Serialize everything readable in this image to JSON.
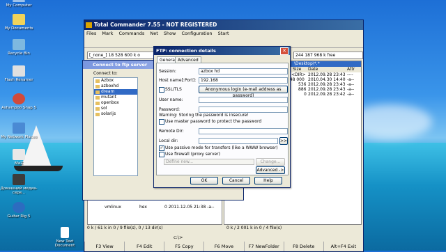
{
  "desktop": {
    "icons": [
      {
        "label": "My Computer"
      },
      {
        "label": "My Documents"
      },
      {
        "label": "Recycle Bin"
      },
      {
        "label": "Flash Renamer"
      },
      {
        "label": "Ashampoo Snap 5"
      },
      {
        "label": "My Network Places"
      },
      {
        "label": "MaZ"
      },
      {
        "label": "Домашний медиа-серв..."
      },
      {
        "label": "Guitar Rig 5"
      },
      {
        "label": "New Text Document"
      }
    ]
  },
  "tc": {
    "title": "Total Commander 7.55 - NOT REGISTERED",
    "menu": [
      "Files",
      "Mark",
      "Commands",
      "Net",
      "Show",
      "Configuration",
      "Start"
    ],
    "left_drive": "[_none_]  18 528 600 k o",
    "right_drive": "244 187 968 k free",
    "right_path": "\\Desktop\\*.*",
    "right_cols": [
      "Size",
      "Date",
      "Attr"
    ],
    "right_rows": [
      {
        "size": "<DIR>",
        "date": "2012.09.28 23:43",
        "attr": "----"
      },
      {
        "size": "048 000",
        "date": "2010.04.30 14:40",
        "attr": "-a--"
      },
      {
        "size": "536",
        "date": "2012.09.28 23:43",
        "attr": "-a--"
      },
      {
        "size": "886",
        "date": "2012.09.28 23:43",
        "attr": "-a--"
      },
      {
        "size": "0",
        "date": "2012.09.28 23:42",
        "attr": "-a--"
      }
    ],
    "left_bottom_rows": [
      {
        "name": "vmlinux",
        "ext": "hex",
        "info": "0  2011.12.05 21:38 -a--"
      }
    ],
    "left_status": "0 k / 61 k in 0 / 9 file(s), 0 / 13 dir(s)",
    "right_status": "0 k / 2 001 k in 0 / 4 file(s)",
    "cmd_prompt": "c:\\>",
    "fkeys": [
      "F3 View",
      "F4 Edit",
      "F5 Copy",
      "F6 Move",
      "F7 NewFolder",
      "F8 Delete",
      "Alt+F4 Exit"
    ]
  },
  "ftp": {
    "title": "Connect to ftp server",
    "list_label": "Connect to:",
    "items": [
      "Azbox",
      "azboxhd",
      "dream",
      "mutant",
      "openbox",
      "sol",
      "solarijs"
    ],
    "selected": "dream"
  },
  "dlg": {
    "title": "FTP: connection details",
    "tabs": [
      "General",
      "Advanced"
    ],
    "session_label": "Session:",
    "session_value": "azbox hd",
    "host_label": "Host name[:Port]:",
    "host_value": "192.168",
    "ssl_label": "SSL/TLS",
    "anon_button": "Anonymous login (e-mail address as password)",
    "user_label": "User name:",
    "user_value": "",
    "password_label": "Password:",
    "warning": "Warning: Storing the password is insecure!",
    "master_pw_label": "Use master password to protect the password",
    "remote_dir_label": "Remote Dir:",
    "local_dir_label": "Local dir:",
    "browse_button": ">>",
    "passive_label": "Use passive mode for transfers (like a WWW browser)",
    "firewall_label": "Use firewall (proxy server)",
    "define_new": "Define new...",
    "change_button": "Change...",
    "advanced_button": "Advanced ->",
    "ok": "OK",
    "cancel": "Cancel",
    "help": "Help"
  }
}
